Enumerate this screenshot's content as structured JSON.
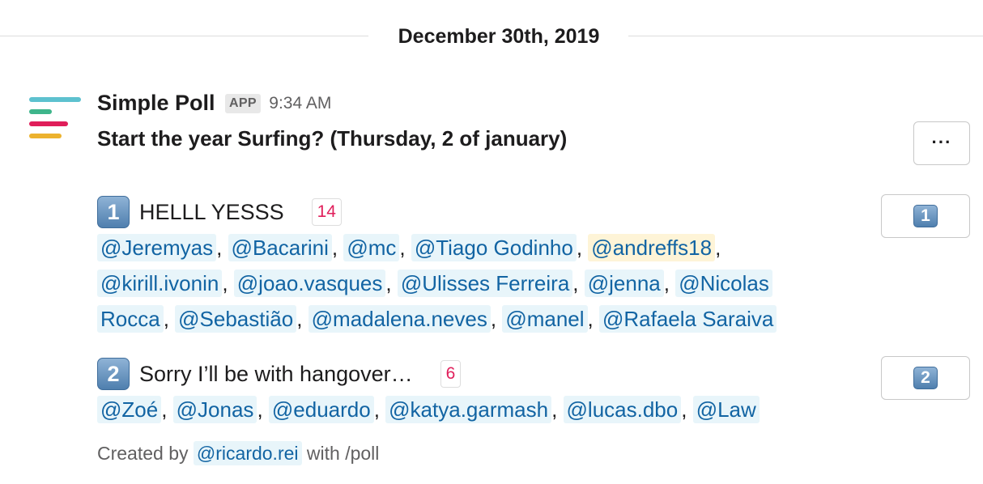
{
  "date_divider": "December 30th, 2019",
  "message": {
    "sender": "Simple Poll",
    "badge": "APP",
    "time": "9:34 AM",
    "question": "Start the year Surfing? (Thursday, 2 of january)",
    "more_label": "···",
    "logo_colors": [
      "#5dc1cf",
      "#3eb58b",
      "#e01e5a",
      "#ecb22e"
    ]
  },
  "options": [
    {
      "number": "1",
      "text": "HELLL YESSS",
      "count": "14",
      "vote_label": "1",
      "voters": [
        "@Jeremyas",
        "@Bacarini",
        "@mc",
        "@Tiago Godinho",
        "@andreffs18",
        "@kirill.ivonin",
        "@joao.vasques",
        "@Ulisses Ferreira",
        "@jenna",
        "@Nicolas Rocca",
        "@Sebastião",
        "@madalena.neves",
        "@manel",
        "@Rafaela Saraiva"
      ],
      "highlighted_voter": "@andreffs18"
    },
    {
      "number": "2",
      "text": "Sorry I’ll be with hangover…",
      "count": "6",
      "vote_label": "2",
      "voters": [
        "@Zoé",
        "@Jonas",
        "@eduardo",
        "@katya.garmash",
        "@lucas.dbo",
        "@Law"
      ]
    }
  ],
  "footer": {
    "prefix": "Created by",
    "creator": "@ricardo.rei",
    "suffix": "with /poll"
  },
  "colors": {
    "mention_text": "#1264a3",
    "mention_bg": "#e8f5fa",
    "mention_highlight_bg": "#fef4d7",
    "count_text": "#e01e5a"
  }
}
